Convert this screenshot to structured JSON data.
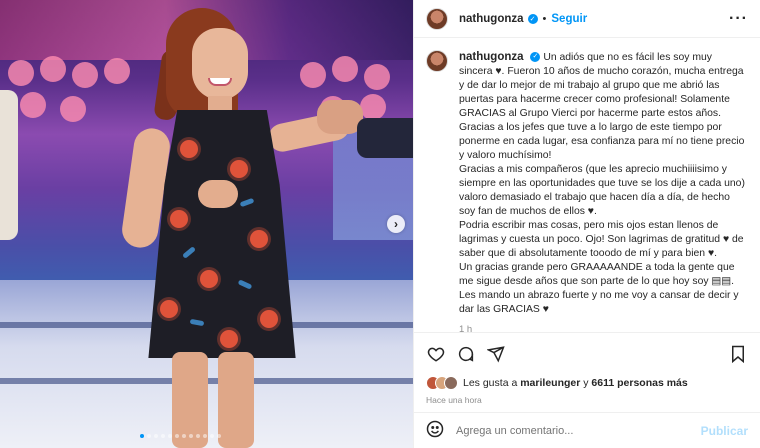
{
  "post": {
    "username": "nathugonza",
    "follow_label": "Seguir",
    "dot_separator": "•",
    "more_icon": "more-horizontal-icon",
    "carousel_dot_count": 12,
    "carousel_active_index": 0
  },
  "caption": {
    "username": "nathugonza",
    "lines": [
      "Un adiós que no es fácil les soy muy sincera ♥. Fueron 10 años de mucho corazón, mucha entrega y de dar lo mejor de mi trabajo al grupo que me abrió las puertas para hacerme crecer como profesional! Solamente GRACIAS al Grupo Vierci por hacerme parte estos años.",
      "Gracias a los jefes que tuve a lo largo de este tiempo por ponerme en cada lugar, esa confianza para mí no tiene precio y valoro muchísimo!",
      "Gracias a mis compañeros (que les aprecio muchiiiisimo y siempre en las oportunidades que tuve se los dije a cada uno) valoro demasiado el trabajo que hacen día a día, de hecho soy fan de muchos de ellos ♥.",
      "Podria escribir mas cosas, pero mis ojos estan llenos de lagrimas y cuesta un poco. Ojo! Son lagrimas de gratitud ♥ de saber que di absolutamente tooodo de mí y para bien ♥.",
      "Un gracias grande pero GRAAAAANDE a toda la gente que me sigue desde años que son parte de lo que hoy soy ▤▤.",
      "Les mando un abrazo fuerte y no me voy a cansar de decir y dar las GRACIAS ♥"
    ],
    "time": "1 h"
  },
  "likes": {
    "prefix": "Les gusta a",
    "user": "marileunger",
    "connector": "y",
    "others": "6611 personas más",
    "face_colors": [
      "#c0563a",
      "#d7a47c",
      "#8a6a5c"
    ]
  },
  "timestamp": "Hace una hora",
  "comment": {
    "placeholder": "Agrega un comentario...",
    "publish_label": "Publicar"
  },
  "colors": {
    "accent": "#0095f6",
    "publish_disabled": "#b2dffc",
    "muted": "#8e8e8e"
  }
}
